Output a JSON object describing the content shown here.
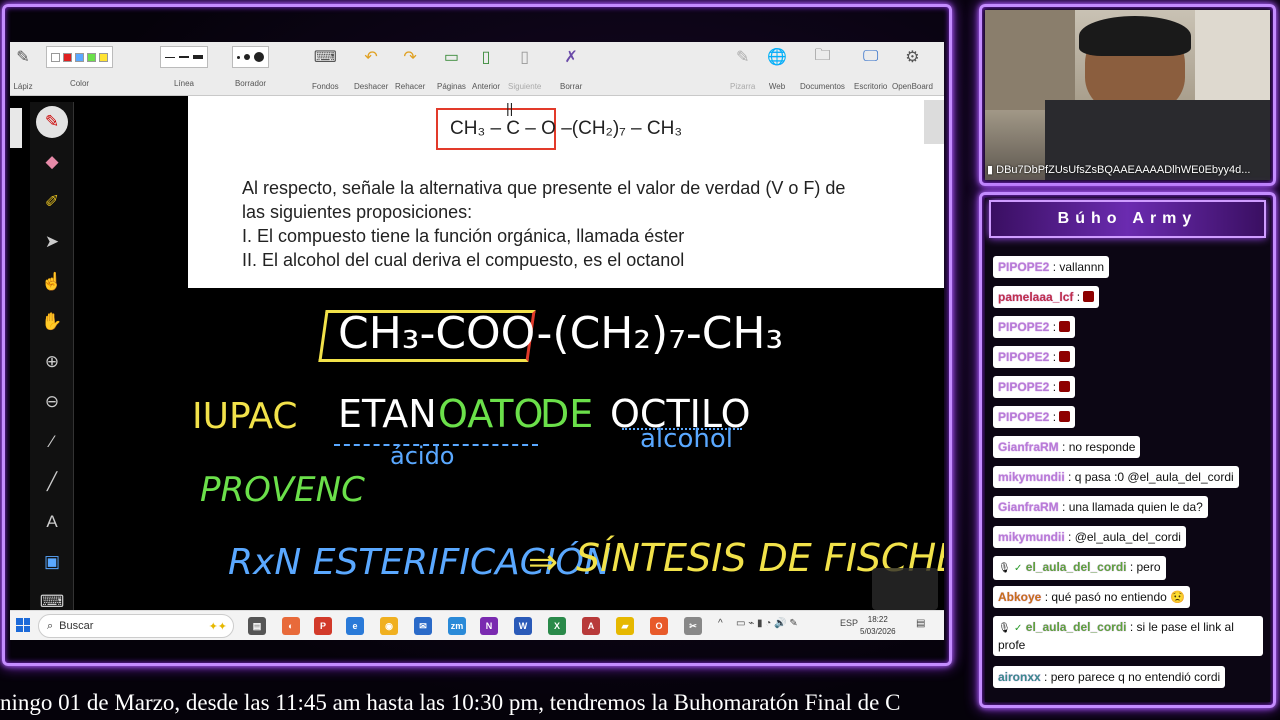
{
  "toolbar": {
    "items": [
      {
        "label": "Lápiz",
        "icon": "pencil-icon"
      },
      {
        "label": "Color",
        "icon": "color-palette"
      },
      {
        "label": "Línea",
        "icon": "line-width"
      },
      {
        "label": "Borrador",
        "icon": "eraser-size"
      },
      {
        "label": "Fondos",
        "icon": "keyboard-icon"
      },
      {
        "label": "Deshacer",
        "icon": "undo-icon"
      },
      {
        "label": "Rehacer",
        "icon": "redo-icon"
      },
      {
        "label": "Páginas",
        "icon": "add-page-icon"
      },
      {
        "label": "Anterior",
        "icon": "previous-page-icon"
      },
      {
        "label": "Siguiente",
        "icon": "next-page-icon"
      },
      {
        "label": "Borrar",
        "icon": "clear-icon"
      },
      {
        "label": "Pizarra",
        "icon": "whiteboard-icon"
      },
      {
        "label": "Web",
        "icon": "globe-icon"
      },
      {
        "label": "Documentos",
        "icon": "folder-icon"
      },
      {
        "label": "Escritorio",
        "icon": "desktop-icon"
      },
      {
        "label": "OpenBoard",
        "icon": "gear-icon"
      }
    ],
    "colors": [
      "#ffffff",
      "#e02020",
      "#5aa8ff",
      "#6be04a",
      "#ffe333"
    ]
  },
  "document": {
    "formula": "CH₃ – C – O –(CH₂)₇ – CH₃",
    "formula_double_bond": "||",
    "lines": [
      "Al respecto, señale la alternativa que presente el valor de verdad (V o F) de",
      "las siguientes proposiciones:",
      "I.   El compuesto tiene la función orgánica, llamada éster",
      "II.  El alcohol del cual deriva el compuesto, es el octanol"
    ]
  },
  "handwriting": {
    "formula": "CH₃-COO-(CH₂)₇-CH₃",
    "iupac_label": "IUPAC",
    "name_part1": "ETAN",
    "name_part2": "OATO",
    "name_part3": "DE",
    "name_part4": "OCTILO",
    "acido": "ácido",
    "alcohol": "alcohol",
    "provenc": "PROVENC",
    "rxn": "RxN ESTERIFICACIÓN",
    "arrow": "⇒",
    "sintesis": "SÍNTESIS DE FISCHER"
  },
  "taskbar": {
    "search_placeholder": "Buscar",
    "time": "18:22",
    "date": "5/03/2026",
    "lang": "ESP"
  },
  "webcam": {
    "caption": "DBu7DbPfZUsUfsZsBQAAEAAAADlhWE0Ebyy4d..."
  },
  "chat": {
    "title": "Búho Army",
    "messages": [
      {
        "user": "PIPOPE2",
        "text": ": vallannn",
        "color": "purple"
      },
      {
        "user": "pamelaaa_lcf",
        "text": ":",
        "color": "red",
        "badge": true
      },
      {
        "user": "PIPOPE2",
        "text": ":",
        "color": "purple",
        "badge": true
      },
      {
        "user": "PIPOPE2",
        "text": ":",
        "color": "purple",
        "badge": true
      },
      {
        "user": "PIPOPE2",
        "text": ":",
        "color": "purple",
        "badge": true
      },
      {
        "user": "PIPOPE2",
        "text": ":",
        "color": "purple",
        "badge": true
      },
      {
        "user": "GianfraRM",
        "text": ": no responde",
        "color": "purple"
      },
      {
        "user": "mikymundii",
        "text": ": q pasa :0 @el_aula_del_cordi",
        "color": "purple"
      },
      {
        "user": "GianfraRM",
        "text": ": una llamada quien le da?",
        "color": "purple"
      },
      {
        "user": "mikymundii",
        "text": ": @el_aula_del_cordi",
        "color": "purple"
      },
      {
        "user": "el_aula_del_cordi",
        "text": ": pero",
        "color": "green",
        "icons": true
      },
      {
        "user": "Abkoye",
        "text": ": qué pasó no entiendo 😟",
        "color": "orange"
      },
      {
        "user": "el_aula_del_cordi",
        "text": ": si le pase el link al profe",
        "color": "green",
        "icons": true
      },
      {
        "user": "aironxx",
        "text": ": pero parece q no entendió cordi",
        "color": "teal"
      }
    ]
  },
  "ticker": {
    "text": "ningo 01 de Marzo, desde las 11:45 am hasta las 10:30 pm, tendremos la Buhomaratón Final de C"
  }
}
